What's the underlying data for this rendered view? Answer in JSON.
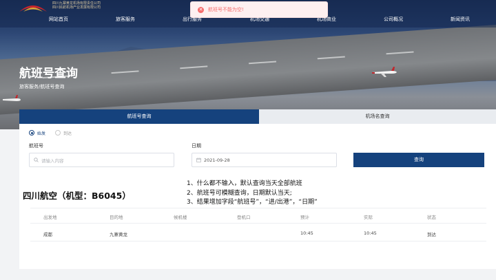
{
  "header": {
    "logo_lines": [
      "四川九寨黄龙机场有限责任公司",
      "四川民航机场产业发展有限公司"
    ],
    "nav": [
      "网站首页",
      "旅客服务",
      "出行服务",
      "机场交通",
      "机场商业",
      "公司概况",
      "新闻资讯"
    ]
  },
  "toast": {
    "message": "航班号不能为空!",
    "type": "error"
  },
  "page": {
    "title": "航班号查询",
    "breadcrumb": "旅客服务/航班号查询"
  },
  "tabs": [
    {
      "label": "航班号查询",
      "active": true
    },
    {
      "label": "机场名查询",
      "active": false
    }
  ],
  "direction": [
    {
      "label": "始发",
      "checked": true
    },
    {
      "label": "到达",
      "checked": false
    }
  ],
  "form": {
    "flight_label": "航班号",
    "flight_placeholder": "请输入内容",
    "date_label": "日期",
    "date_value": "2021-09-28",
    "search_button": "查询"
  },
  "result": {
    "title": "四川航空（机型：B6045）"
  },
  "notes": [
    "1、什么都不输入，默认查询当天全部航班",
    "2、航班号可模糊查询，日期默认当天;",
    "3、结果增加字段“航班号”，“进/出港”，“日期”"
  ],
  "table": {
    "columns": [
      "出发地",
      "目的地",
      "候机楼",
      "登机口",
      "预计",
      "实际",
      "状态"
    ],
    "rows": [
      [
        "成都",
        "九寨黄龙",
        "",
        "",
        "10:45",
        "10:45",
        "到达"
      ]
    ]
  },
  "colors": {
    "primary": "#15427d",
    "error": "#f56c6c",
    "header_bg": "#1b2f55"
  }
}
